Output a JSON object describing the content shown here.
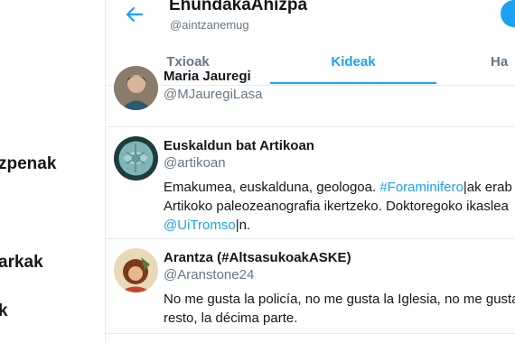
{
  "nav": {
    "items": [
      "zpenak",
      "arkak",
      "k"
    ]
  },
  "header": {
    "title": "EhundakaAhizpa",
    "handle": "@aintzanemug"
  },
  "tabs": [
    "Txioak",
    "Kideak",
    "Ha"
  ],
  "active_tab": "Kideak",
  "members": [
    {
      "name": "Maria Jauregi",
      "handle": "@MJauregiLasa"
    },
    {
      "name": "Euskaldun bat Artikoan",
      "handle": "@artikoan",
      "bio": {
        "l1a": "Emakumea, euskalduna, geologoa. ",
        "l1link": "#Foraminifero",
        "l1b": "|ak erab",
        "l2": "Artikoko paleozeanografia ikertzeko. Doktoregoko ikaslea",
        "l3link": "@UiTromso",
        "l3b": "|n."
      }
    },
    {
      "name": "Arantza (#AltsasukoakASKE)",
      "handle": "@Aranstone24",
      "bio": {
        "l1": "No me gusta la policía, no me gusta la Iglesia, no me gusta",
        "l2": "resto, la décima parte."
      }
    }
  ],
  "colors": {
    "accent": "#1da1f2",
    "text": "#14171a",
    "muted": "#657786",
    "border": "#e6ecf0"
  }
}
